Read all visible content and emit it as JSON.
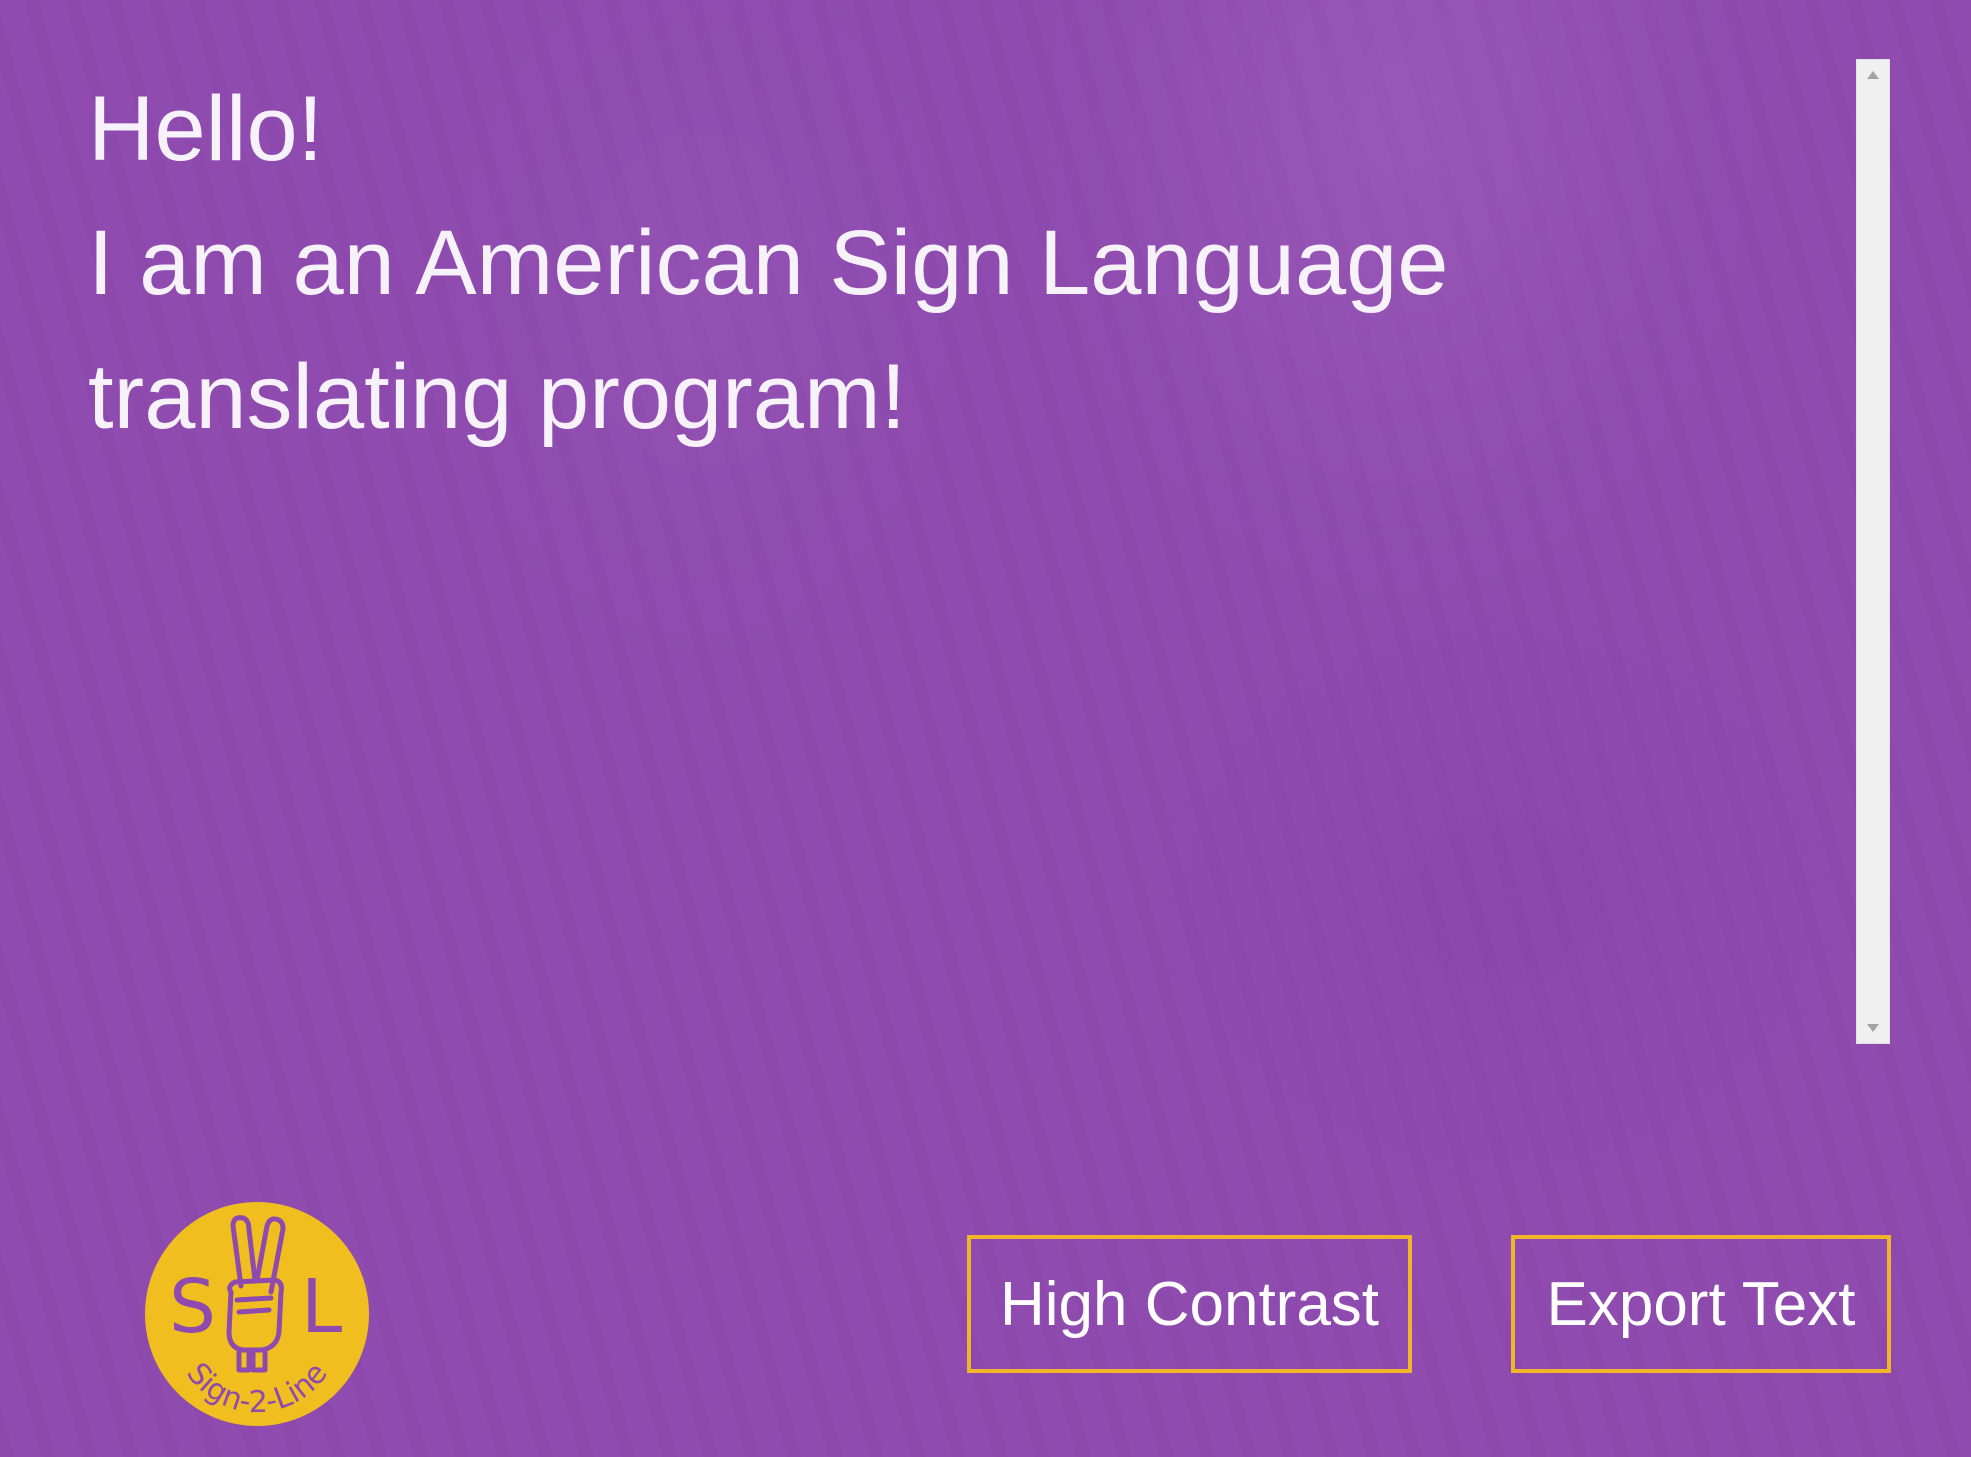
{
  "transcript": {
    "lines": [
      "Hello!",
      "I am an American Sign Language",
      "translating program!"
    ]
  },
  "buttons": {
    "high_contrast": "High Contrast",
    "export_text": "Export Text"
  },
  "logo": {
    "letters_left": "S",
    "letters_right": "L",
    "tagline": "Sign-2-Line",
    "icon": "peace-sign-hand-icon"
  },
  "colors": {
    "background": "#8e4aae",
    "text": "#f7f1fa",
    "accent": "#f0b62a",
    "logo_fill": "#f0be1e",
    "logo_ink": "#8e4aae"
  }
}
